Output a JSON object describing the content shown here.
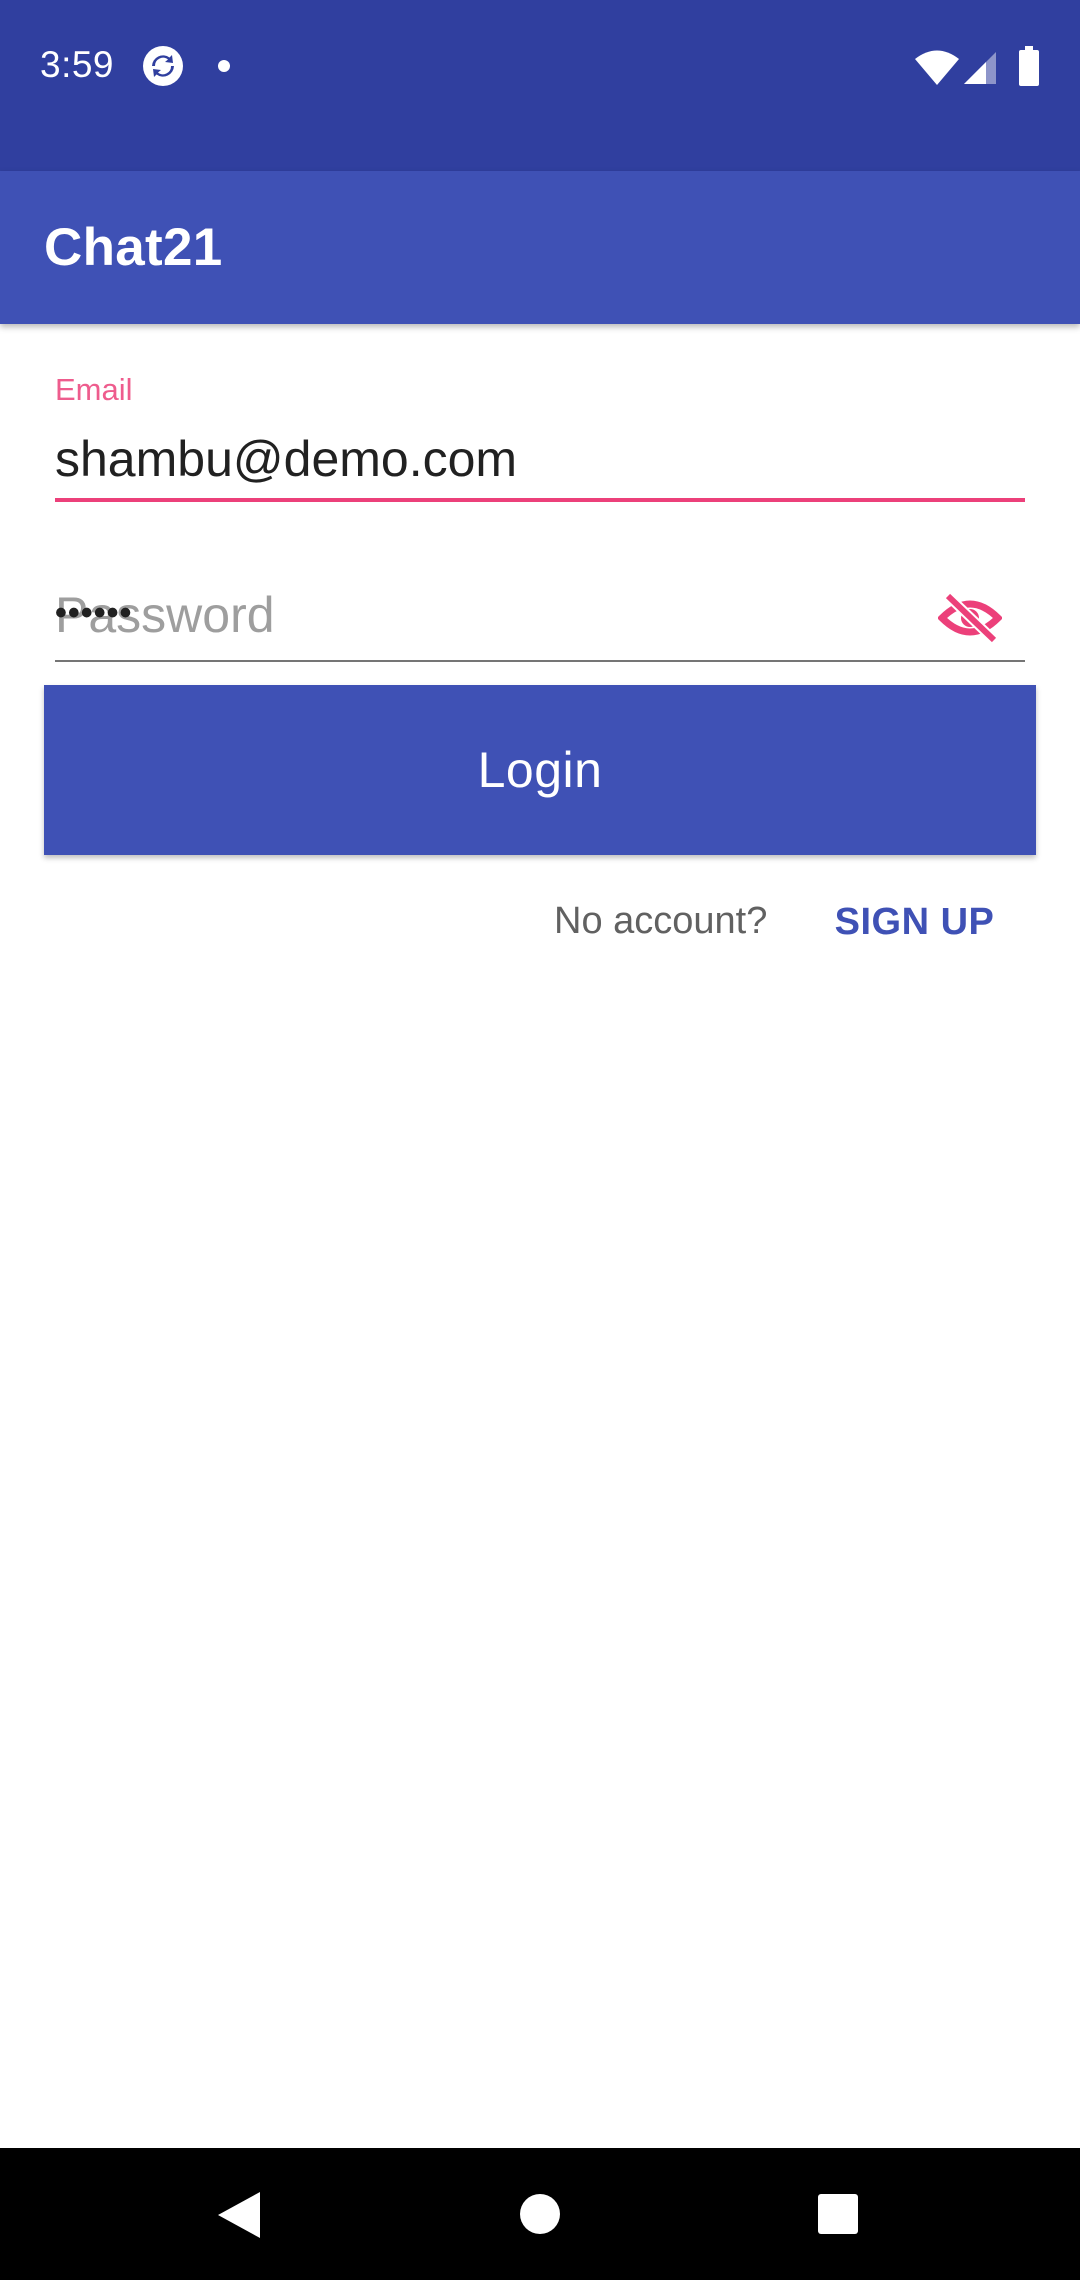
{
  "status_bar": {
    "time": "3:59",
    "icons": [
      "sync-icon",
      "dot-icon",
      "wifi-icon",
      "signal-icon",
      "battery-icon"
    ]
  },
  "app_bar": {
    "title": "Chat21"
  },
  "login_form": {
    "email": {
      "label": "Email",
      "value": "shambu@demo.com"
    },
    "password": {
      "placeholder": "Password",
      "masked_value": "••••••",
      "toggle_icon": "visibility-off-icon"
    },
    "login_label": "Login",
    "no_account_text": "No account?",
    "signup_label": "SIGN UP"
  },
  "nav_bar": {
    "icons": [
      "back-icon",
      "home-icon",
      "recents-icon"
    ]
  },
  "colors": {
    "status_bar": "#303F9F",
    "primary": "#3F51B5",
    "accent": "#EC407A",
    "background": "#FFFFFF"
  }
}
